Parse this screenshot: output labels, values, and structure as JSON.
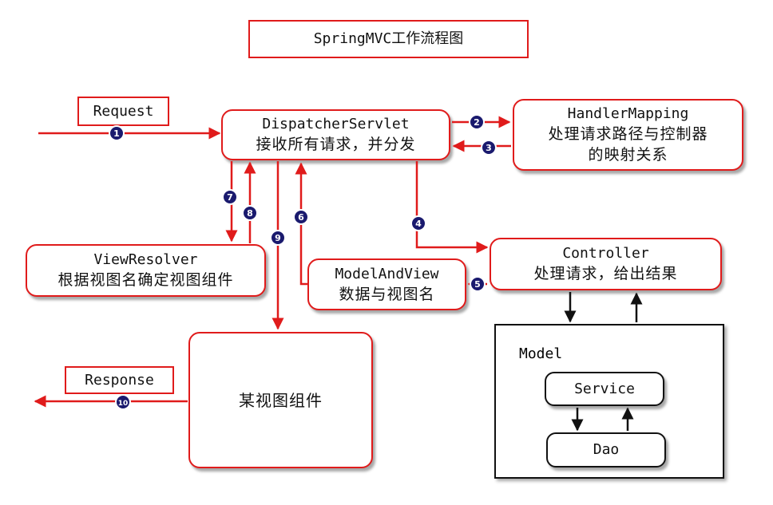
{
  "title": "SpringMVC工作流程图",
  "request_label": "Request",
  "response_label": "Response",
  "nodes": {
    "dispatcher": {
      "name": "DispatcherServlet",
      "desc": "接收所有请求，并分发"
    },
    "handler_mapping": {
      "name": "HandlerMapping",
      "desc_line1": "处理请求路径与控制器",
      "desc_line2": "的映射关系"
    },
    "controller": {
      "name": "Controller",
      "desc": "处理请求，给出结果"
    },
    "view_resolver": {
      "name": "ViewResolver",
      "desc": "根据视图名确定视图组件"
    },
    "model_and_view": {
      "name": "ModelAndView",
      "desc": "数据与视图名"
    },
    "view_component": {
      "desc": "某视图组件"
    },
    "model": {
      "label": "Model",
      "service": "Service",
      "dao": "Dao"
    }
  },
  "steps": [
    "1",
    "2",
    "3",
    "4",
    "5",
    "6",
    "7",
    "8",
    "9",
    "10"
  ],
  "colors": {
    "accent": "#e01b1b",
    "badge": "#1a1a6e",
    "black": "#111111"
  }
}
